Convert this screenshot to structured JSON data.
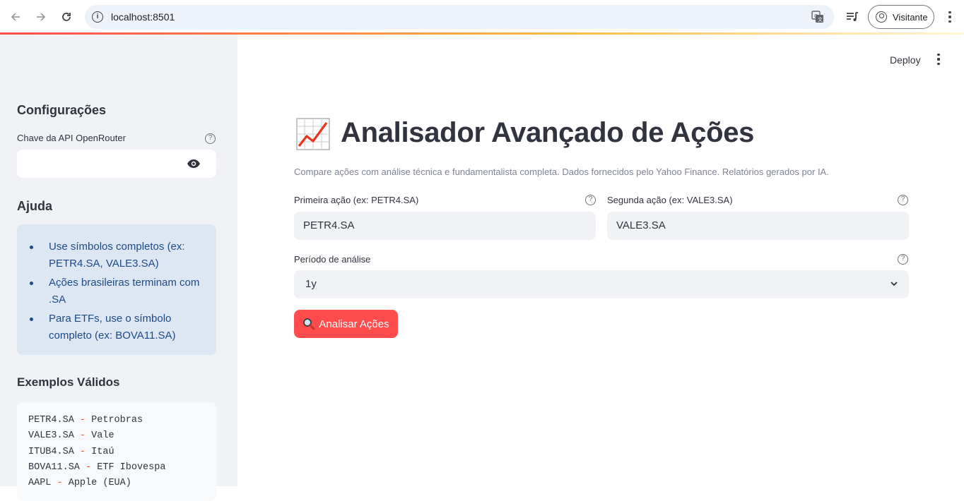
{
  "browser": {
    "url": "localhost:8501",
    "profile_label": "Visitante"
  },
  "sidebar": {
    "config_title": "Configurações",
    "api_key_label": "Chave da API OpenRouter",
    "api_key_value": "",
    "help_title": "Ajuda",
    "help_items": [
      "Use símbolos completos (ex: PETR4.SA, VALE3.SA)",
      "Ações brasileiras terminam com .SA",
      "Para ETFs, use o símbolo completo (ex: BOVA11.SA)"
    ],
    "examples_title": "Exemplos Válidos",
    "examples": [
      {
        "symbol": "PETR4.SA",
        "sep": "-",
        "name": "Petrobras"
      },
      {
        "symbol": "VALE3.SA",
        "sep": "-",
        "name": "Vale"
      },
      {
        "symbol": "ITUB4.SA",
        "sep": "-",
        "name": "Itaú"
      },
      {
        "symbol": "BOVA11.SA",
        "sep": "-",
        "name": "ETF Ibovespa"
      },
      {
        "symbol": "AAPL",
        "sep": "-",
        "name": "Apple (EUA)"
      }
    ]
  },
  "header": {
    "deploy_label": "Deploy"
  },
  "main": {
    "title": "Analisador Avançado de Ações",
    "caption": "Compare ações com análise técnica e fundamentalista completa. Dados fornecidos pelo Yahoo Finance. Relatórios gerados por IA.",
    "first_stock_label": "Primeira ação (ex: PETR4.SA)",
    "first_stock_value": "PETR4.SA",
    "second_stock_label": "Segunda ação (ex: VALE3.SA)",
    "second_stock_value": "VALE3.SA",
    "period_label": "Período de análise",
    "period_value": "1y",
    "analyze_button": "Analisar Ações"
  },
  "colors": {
    "primary": "#ff4b4b",
    "sidebar_bg": "#f0f2f6",
    "info_bg": "#dde7f3",
    "info_text": "#1c4a86"
  }
}
